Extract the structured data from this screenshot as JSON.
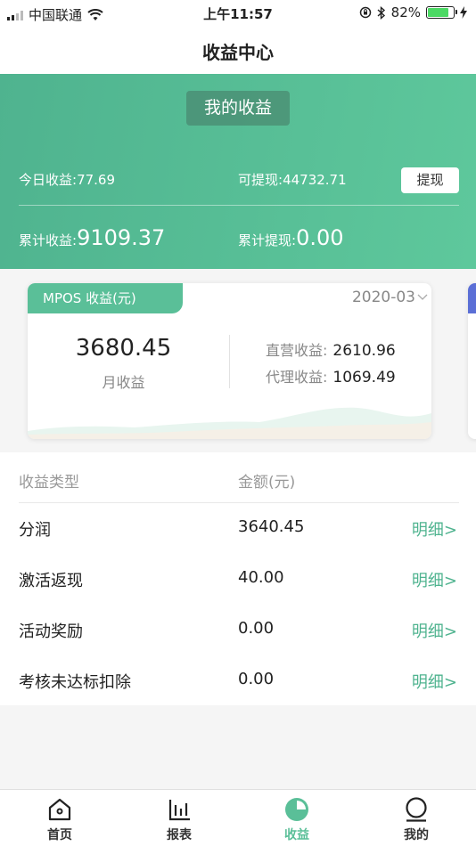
{
  "status_bar": {
    "carrier": "中国联通",
    "time": "上午11:57",
    "battery": "82%",
    "battery_level": 0.82
  },
  "nav": {
    "title": "收益中心"
  },
  "banner": {
    "pill_label": "我的收益",
    "today_label": "今日收益:",
    "today_value": "77.69",
    "withdrawable_label": "可提现:",
    "withdrawable_value": "44732.71",
    "withdraw_button": "提现",
    "total_income_label": "累计收益:",
    "total_income_value": "9109.37",
    "total_withdraw_label": "累计提现:",
    "total_withdraw_value": "0.00"
  },
  "card": {
    "tag": "MPOS 收益(元)",
    "date": "2020-03",
    "month_value": "3680.45",
    "month_label": "月收益",
    "direct_label": "直营收益:",
    "direct_value": "2610.96",
    "agent_label": "代理收益:",
    "agent_value": "1069.49"
  },
  "table": {
    "header_type": "收益类型",
    "header_amount": "金额(元)",
    "rows": [
      {
        "type": "分润",
        "amount": "3640.45",
        "detail": "明细>"
      },
      {
        "type": "激活返现",
        "amount": "40.00",
        "detail": "明细>"
      },
      {
        "type": "活动奖励",
        "amount": "0.00",
        "detail": "明细>"
      },
      {
        "type": "考核未达标扣除",
        "amount": "0.00",
        "detail": "明细>"
      }
    ]
  },
  "tabs": [
    {
      "label": "首页",
      "icon": "home-icon"
    },
    {
      "label": "报表",
      "icon": "bar-chart-icon"
    },
    {
      "label": "收益",
      "icon": "pie-chart-icon",
      "active": true
    },
    {
      "label": "我的",
      "icon": "user-icon"
    }
  ],
  "colors": {
    "accent": "#5abf98",
    "banner_start": "#4fb38f",
    "banner_end": "#5ec89c",
    "detail_link": "#4fb38f"
  }
}
